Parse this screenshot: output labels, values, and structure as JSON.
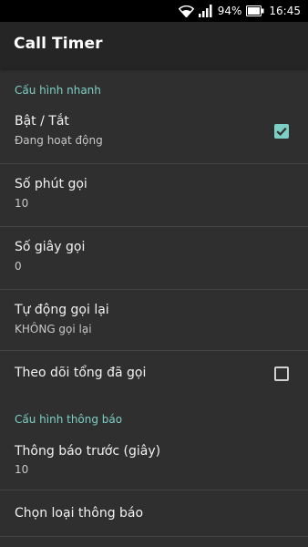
{
  "status_bar": {
    "battery": "94%",
    "time": "16:45",
    "icons": [
      "wifi-icon",
      "signal-icon",
      "battery-icon"
    ]
  },
  "app_bar": {
    "title": "Call Timer"
  },
  "sections": [
    {
      "header": "Cấu hình nhanh",
      "items": [
        {
          "title": "Bật / Tắt",
          "subtitle": "Đang hoạt động",
          "checkbox": true
        },
        {
          "title": "Số phút gọi",
          "subtitle": "10"
        },
        {
          "title": "Số giây gọi",
          "subtitle": "0"
        },
        {
          "title": "Tự động gọi lại",
          "subtitle": "KHÔNG gọi lại"
        },
        {
          "title": "Theo dõi tổng đã gọi",
          "checkbox": false
        }
      ]
    },
    {
      "header": "Cấu hình thông báo",
      "items": [
        {
          "title": "Thông báo trước (giây)",
          "subtitle": "10"
        },
        {
          "title": "Chọn loại thông báo"
        }
      ]
    }
  ],
  "colors": {
    "accent": "#7ccfc5",
    "background": "#2f2f2f",
    "app_bar": "#252525",
    "status_bar": "#000000",
    "divider": "#444444"
  }
}
